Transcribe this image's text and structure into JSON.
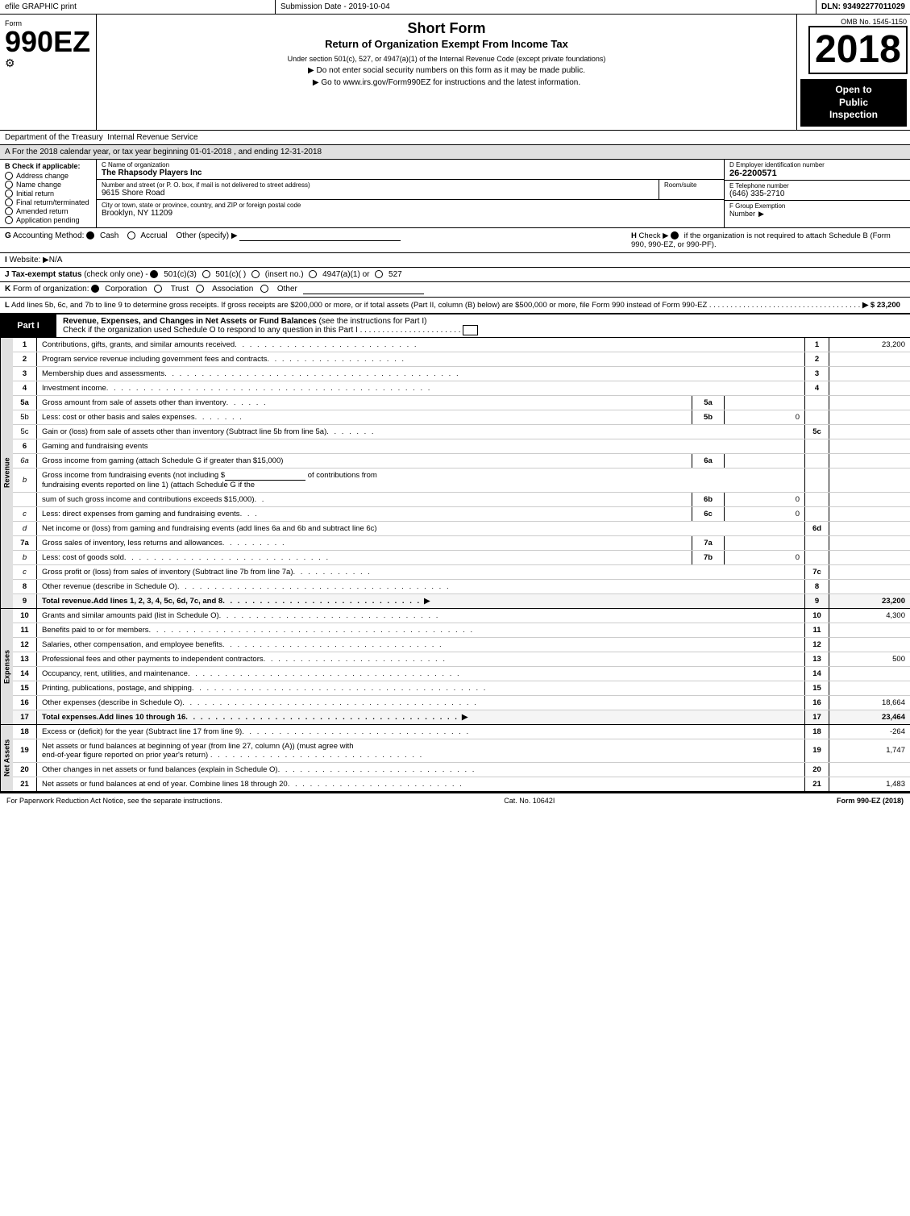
{
  "topbar": {
    "left": "efile GRAPHIC print",
    "center": "Submission Date - 2019-10-04",
    "right": "DLN: 93492277011029"
  },
  "form": {
    "number": "990EZ",
    "label": "Form",
    "sub": "⚙",
    "title": "Short Form",
    "subtitle": "Return of Organization Exempt From Income Tax",
    "note": "Under section 501(c), 527, or 4947(a)(1) of the Internal Revenue Code (except private foundations)",
    "social_security": "▶ Do not enter social security numbers on this form as it may be made public.",
    "irs_link": "▶ Go to www.irs.gov/Form990EZ for instructions and the latest information.",
    "year": "2018",
    "omb": "OMB No. 1545-1150",
    "open_to_public": "Open to\nPublic\nInspection"
  },
  "dept": {
    "text": "Department of the Treasury\nInternal Revenue Service"
  },
  "period": {
    "text": "A For the 2018 calendar year, or tax year beginning 01-01-2018",
    "ending": ", and ending 12-31-2018"
  },
  "checkboxes": {
    "label": "B Check if applicable:",
    "items": [
      {
        "id": "address",
        "label": "Address change",
        "checked": false
      },
      {
        "id": "name",
        "label": "Name change",
        "checked": false
      },
      {
        "id": "initial",
        "label": "Initial return",
        "checked": false
      },
      {
        "id": "final",
        "label": "Final return/terminated",
        "checked": false
      },
      {
        "id": "amended",
        "label": "Amended return",
        "checked": false
      },
      {
        "id": "pending",
        "label": "Application pending",
        "checked": false
      }
    ]
  },
  "org": {
    "name_label": "C Name of organization",
    "name_value": "The Rhapsody Players Inc",
    "street_label": "Number and street (or P. O. box, if mail is not delivered to street address)",
    "street_value": "9615 Shore Road",
    "room_label": "Room/suite",
    "room_value": "",
    "city_label": "City or town, state or province, country, and ZIP or foreign postal code",
    "city_value": "Brooklyn, NY  11209",
    "ein_label": "D Employer identification number",
    "ein_value": "26-2200571",
    "phone_label": "E Telephone number",
    "phone_value": "(646) 335-2710",
    "exempt_label": "F Group Exemption",
    "exempt_sub": "Number",
    "exempt_value": "▶"
  },
  "section_g": {
    "label": "G",
    "text": "Accounting Method:",
    "cash_label": "Cash",
    "cash_checked": true,
    "accrual_label": "Accrual",
    "accrual_checked": false,
    "other_label": "Other (specify) ▶",
    "h_label": "H",
    "h_text": "Check ▶",
    "h_filled": true,
    "h_rest": "if the organization is not required to attach Schedule B (Form 990, 990-EZ, or 990-PF)."
  },
  "section_i": {
    "label": "I",
    "text": "Website: ▶N/A"
  },
  "section_j": {
    "label": "J",
    "text": "Tax-exempt status",
    "check_note": "(check only one) -",
    "options": [
      {
        "val": "501(c)(3)",
        "checked": true
      },
      {
        "val": "501(c)(  )",
        "checked": false
      },
      {
        "val": "(insert no.)",
        "checked": false
      },
      {
        "val": "4947(a)(1) or",
        "checked": false
      },
      {
        "val": "527",
        "checked": false
      }
    ]
  },
  "section_k": {
    "label": "K",
    "text": "Form of organization:",
    "options": [
      {
        "val": "Corporation",
        "checked": true
      },
      {
        "val": "Trust",
        "checked": false
      },
      {
        "val": "Association",
        "checked": false
      },
      {
        "val": "Other",
        "checked": false
      }
    ]
  },
  "section_l": {
    "label": "L",
    "text": "Add lines 5b, 6c, and 7b to line 9 to determine gross receipts. If gross receipts are $200,000 or more, or if total assets (Part II, column (B) below) are $500,000 or more, file Form 990 instead of Form 990-EZ",
    "dots": ". . . . . . . . . . . . . . . . . . . . . . . . . . . . . . . . . . . .",
    "arrow": "▶",
    "value": "$ 23,200"
  },
  "part1": {
    "label": "Part I",
    "title": "Revenue, Expenses, and Changes in Net Assets or Fund Balances",
    "see_note": "(see the instructions for Part I)",
    "schedule_check": "Check if the organization used Schedule O to respond to any question in this Part I",
    "dots": ". . . . . . . . . . . . . . . . . . . . . . .",
    "schedule_box": "✓"
  },
  "revenue_rows": [
    {
      "num": "1",
      "desc": "Contributions, gifts, grants, and similar amounts received",
      "dots": ". . . . . . . . . . . . . . . . . . . . . . . . . .",
      "line": "1",
      "value": "23,200"
    },
    {
      "num": "2",
      "desc": "Program service revenue including government fees and contracts",
      "dots": ". . . . . . . . . . . . . . . . . . .",
      "line": "2",
      "value": ""
    },
    {
      "num": "3",
      "desc": "Membership dues and assessments",
      "dots": ". . . . . . . . . . . . . . . . . . . . . . . . . . . . . . . . . . . . . . . .",
      "line": "3",
      "value": ""
    },
    {
      "num": "4",
      "desc": "Investment income",
      "dots": ". . . . . . . . . . . . . . . . . . . . . . . . . . . . . . . . . . . . . . . . . . . .",
      "line": "4",
      "value": ""
    },
    {
      "num": "5a",
      "desc": "Gross amount from sale of assets other than inventory",
      "dots": ". . . . . .",
      "col_label": "5a",
      "mid_value": ""
    },
    {
      "num": "5b",
      "desc": "Less: cost or other basis and sales expenses",
      "dots": ". . . . . . .",
      "col_label": "5b",
      "mid_value": "0"
    },
    {
      "num": "5c",
      "desc": "Gain or (loss) from sale of assets other than inventory (Subtract line 5b from line 5a)",
      "dots": ". . . . . . .",
      "line": "5c",
      "value": ""
    },
    {
      "num": "6",
      "desc": "Gaming and fundraising events",
      "dots": "",
      "line": "",
      "value": ""
    },
    {
      "num": "6a",
      "desc": "Gross income from gaming (attach Schedule G if greater than $15,000)",
      "col_label": "6a",
      "mid_value": ""
    },
    {
      "num": "6b_desc",
      "desc": "Gross income from fundraising events (not including $",
      "dots": "",
      "col_label": "",
      "mid_value": ""
    },
    {
      "num": "6b",
      "desc": "sum of such gross income and contributions exceeds $15,000)",
      "dots": ". .",
      "col_label": "6b",
      "mid_value": "0"
    },
    {
      "num": "6c",
      "desc": "Less: direct expenses from gaming and fundraising events",
      "dots": ". . .",
      "col_label": "6c",
      "mid_value": "0"
    },
    {
      "num": "6d",
      "desc": "Net income or (loss) from gaming and fundraising events (add lines 6a and 6b and subtract line 6c)",
      "dots": "",
      "line": "6d",
      "value": ""
    },
    {
      "num": "7a",
      "desc": "Gross sales of inventory, less returns and allowances",
      "dots": ". . . . . . . . .",
      "col_label": "7a",
      "mid_value": ""
    },
    {
      "num": "7b",
      "desc": "Less: cost of goods sold",
      "dots": ". . . . . . . . . . . . . . . . . . . . . . . . . . . .",
      "col_label": "7b",
      "mid_value": "0"
    },
    {
      "num": "7c",
      "desc": "Gross profit or (loss) from sales of inventory (Subtract line 7b from line 7a)",
      "dots": ". . . . . . . . . . .",
      "line": "7c",
      "value": ""
    },
    {
      "num": "8",
      "desc": "Other revenue (describe in Schedule O)",
      "dots": ". . . . . . . . . . . . . . . . . . . . . . . . . . . . . . . . . . . . .",
      "line": "8",
      "value": ""
    },
    {
      "num": "9",
      "desc": "Total revenue. Add lines 1, 2, 3, 4, 5c, 6d, 7c, and 8",
      "dots": ". . . . . . . . . . . . . . . . . . . . . . . . . . .",
      "line": "9",
      "value": "23,200",
      "bold": true,
      "arrow": true
    }
  ],
  "expenses_rows": [
    {
      "num": "10",
      "desc": "Grants and similar amounts paid (list in Schedule O)",
      "dots": ". . . . . . . . . . . . . . . . . . . . . . . . . . . . . .",
      "line": "10",
      "value": "4,300"
    },
    {
      "num": "11",
      "desc": "Benefits paid to or for members",
      "dots": ". . . . . . . . . . . . . . . . . . . . . . . . . . . . . . . . . . . . . . . . . . . . .",
      "line": "11",
      "value": ""
    },
    {
      "num": "12",
      "desc": "Salaries, other compensation, and employee benefits",
      "dots": ". . . . . . . . . . . . . . . . . . . . . . . . . . . . . .",
      "line": "12",
      "value": ""
    },
    {
      "num": "13",
      "desc": "Professional fees and other payments to independent contractors",
      "dots": ". . . . . . . . . . . . . . . . . . . . . . . . . .",
      "line": "13",
      "value": "500"
    },
    {
      "num": "14",
      "desc": "Occupancy, rent, utilities, and maintenance",
      "dots": ". . . . . . . . . . . . . . . . . . . . . . . . . . . . . . . . . . . . . .",
      "line": "14",
      "value": ""
    },
    {
      "num": "15",
      "desc": "Printing, publications, postage, and shipping",
      "dots": ". . . . . . . . . . . . . . . . . . . . . . . . . . . . . . . . . . . . . . . . .",
      "line": "15",
      "value": ""
    },
    {
      "num": "16",
      "desc": "Other expenses (describe in Schedule O)",
      "dots": ". . . . . . . . . . . . . . . . . . . . . . . . . . . . . . . . . . . . . . . .",
      "line": "16",
      "value": "18,664"
    },
    {
      "num": "17",
      "desc": "Total expenses. Add lines 10 through 16",
      "dots": ". . . . . . . . . . . . . . . . . . . . . . . . . . . . . . . . . . . . .",
      "line": "17",
      "value": "23,464",
      "bold": true,
      "arrow": true
    }
  ],
  "netassets_rows": [
    {
      "num": "18",
      "desc": "Excess or (deficit) for the year (Subtract line 17 from line 9)",
      "dots": ". . . . . . . . . . . . . . . . . . . . . . . . . . . . . . . .",
      "line": "18",
      "value": "-264"
    },
    {
      "num": "19",
      "desc": "Net assets or fund balances at beginning of year (from line 27, column (A)) (must agree with end-of-year figure reported on prior year's return)",
      "dots": ". . . . . . . . . . . . . . . . . . . . . . . . . . . . . .",
      "line": "19",
      "value": "1,747"
    },
    {
      "num": "20",
      "desc": "Other changes in net assets or fund balances (explain in Schedule O)",
      "dots": ". . . . . . . . . . . . . . . . . . . . . . . . . . .",
      "line": "20",
      "value": ""
    },
    {
      "num": "21",
      "desc": "Net assets or fund balances at end of year. Combine lines 18 through 20",
      "dots": ". . . . . . . . . . . . . . . . . . . . . . . .",
      "line": "21",
      "value": "1,483"
    }
  ],
  "footer": {
    "left": "For Paperwork Reduction Act Notice, see the separate instructions.",
    "center": "Cat. No. 10642I",
    "right": "Form 990-EZ (2018)"
  }
}
